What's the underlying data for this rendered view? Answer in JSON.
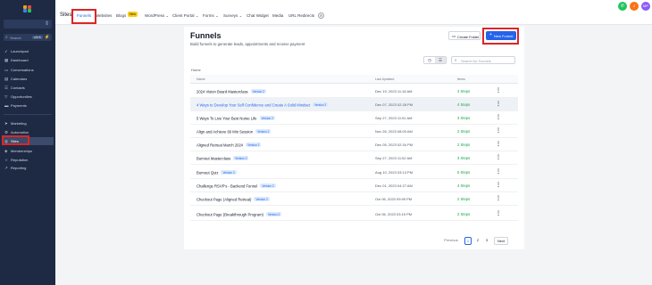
{
  "sidebar": {
    "search": {
      "placeholder": "Search",
      "shortcut": "ctrl K"
    },
    "items": [
      {
        "label": "Launchpad",
        "icon": "rocket-icon"
      },
      {
        "label": "Dashboard",
        "icon": "dashboard-icon"
      },
      {
        "label": "Conversations",
        "icon": "chat-icon"
      },
      {
        "label": "Calendars",
        "icon": "calendar-icon"
      },
      {
        "label": "Contacts",
        "icon": "contacts-icon"
      },
      {
        "label": "Opportunities",
        "icon": "filter-icon"
      },
      {
        "label": "Payments",
        "icon": "payments-icon"
      },
      {
        "label": "Marketing",
        "icon": "send-icon"
      },
      {
        "label": "Automation",
        "icon": "automation-icon"
      },
      {
        "label": "Sites",
        "icon": "globe-icon"
      },
      {
        "label": "Memberships",
        "icon": "memberships-icon"
      },
      {
        "label": "Reputation",
        "icon": "star-icon"
      },
      {
        "label": "Reporting",
        "icon": "chart-icon"
      }
    ]
  },
  "topbar": {
    "title": "Sites",
    "tabs": [
      {
        "label": "Funnels"
      },
      {
        "label": "Websites"
      },
      {
        "label": "Blogs"
      },
      {
        "label": "WordPress ⌄"
      },
      {
        "label": "Client Portal ⌄"
      },
      {
        "label": "Forms ⌄"
      },
      {
        "label": "Surveys ⌄"
      },
      {
        "label": "Chat Widget"
      },
      {
        "label": "Media"
      },
      {
        "label": "URL Redirects"
      }
    ],
    "new_badge": "New",
    "avatar_initials": "MP"
  },
  "page": {
    "title": "Funnels",
    "subtitle": "Build funnels to generate leads, appointments and receive payment",
    "create_folder": "Create Folder",
    "new_funnel": "New Funnel",
    "search_placeholder": "Search for Funnels",
    "breadcrumb": "Home"
  },
  "table": {
    "columns": [
      "Name",
      "Last Updated",
      "Items"
    ],
    "rows": [
      {
        "name": "2024 Vision Board Masterclass",
        "version": "Version 2",
        "updated": "Dec 19, 2023 11:18 AM",
        "steps": "4 Steps"
      },
      {
        "name": "4 Ways to Develop Your Self Confidence and Create A Solid Mindset",
        "version": "Version 2",
        "updated": "Dec 07, 2023 02:28 PM",
        "steps": "4 Steps"
      },
      {
        "name": "5 Ways To Live Your Best Nurse Life",
        "version": "Version 2",
        "updated": "Sep 27, 2023 11:51 AM",
        "steps": "3 Steps"
      },
      {
        "name": "Align and Achieve 60 Min Session",
        "version": "Version 2",
        "updated": "Nov 26, 2023 08:00 AM",
        "steps": "2 Steps"
      },
      {
        "name": "Aligned Retreat March 2024",
        "version": "Version 2",
        "updated": "Dec 05, 2023 02:34 PM",
        "steps": "2 Steps"
      },
      {
        "name": "Burnout Masterclass",
        "version": "Version 2",
        "updated": "Sep 27, 2023 11:52 AM",
        "steps": "3 Steps"
      },
      {
        "name": "Burnout Quiz",
        "version": "Version 2",
        "updated": "Aug 10, 2023 03:13 PM",
        "steps": "5 Steps"
      },
      {
        "name": "Challenge RSVP's - Backend Funnel",
        "version": "Version 2",
        "updated": "Dec 01, 2023 04:27 AM",
        "steps": "4 Steps"
      },
      {
        "name": "Checkout Page (Aligned Retreat)",
        "version": "Version 2",
        "updated": "Oct 06, 2023 09:09 PM",
        "steps": "2 Steps"
      },
      {
        "name": "Checkout Page (Breakthrough Program)",
        "version": "Version 2",
        "updated": "Oct 06, 2023 03:15 PM",
        "steps": "2 Steps"
      }
    ]
  },
  "pagination": {
    "previous": "Previous",
    "pages": [
      "1",
      "2",
      "3"
    ],
    "next": "Next"
  },
  "colors": {
    "sidebar_bg": "#1e2a44",
    "accent": "#2563eb",
    "highlight": "#dc2626",
    "steps": "#16a34a"
  }
}
